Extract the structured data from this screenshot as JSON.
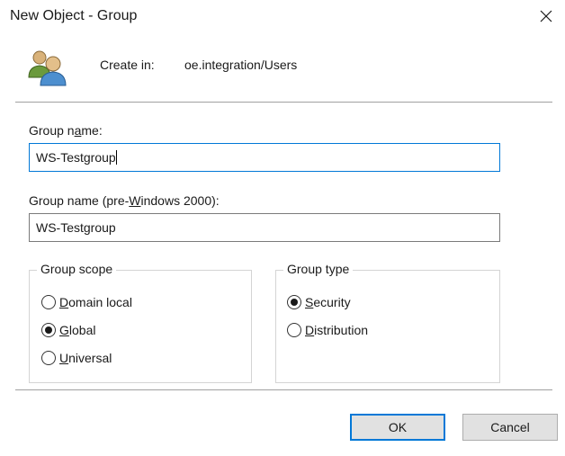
{
  "window": {
    "title": "New Object - Group",
    "close_symbol": "✕"
  },
  "header": {
    "icon": "group-users-icon",
    "create_in_label": "Create in:",
    "create_in_path": "oe.integration/Users"
  },
  "form": {
    "group_name": {
      "label_pre": "Group n",
      "label_underlined": "a",
      "label_post": "me:",
      "value": "WS-Testgroup"
    },
    "group_name_pre2000": {
      "label_pre": "Group name (pre-",
      "label_underlined": "W",
      "label_post": "indows 2000):",
      "value": "WS-Testgroup"
    }
  },
  "group_scope": {
    "title": "Group scope",
    "selected": "Global",
    "options": [
      {
        "pre": "",
        "underlined": "D",
        "post": "omain local",
        "checked": false
      },
      {
        "pre": "",
        "underlined": "G",
        "post": "lobal",
        "checked": true
      },
      {
        "pre": "",
        "underlined": "U",
        "post": "niversal",
        "checked": false
      }
    ]
  },
  "group_type": {
    "title": "Group type",
    "selected": "Security",
    "options": [
      {
        "pre": "",
        "underlined": "S",
        "post": "ecurity",
        "checked": true
      },
      {
        "pre": "",
        "underlined": "D",
        "post": "istribution",
        "checked": false
      }
    ]
  },
  "buttons": {
    "ok_label": "OK",
    "cancel_label": "Cancel"
  },
  "colors": {
    "accent": "#0078d7",
    "button_face": "#e1e1e1",
    "group_border": "#d4d4d4"
  }
}
